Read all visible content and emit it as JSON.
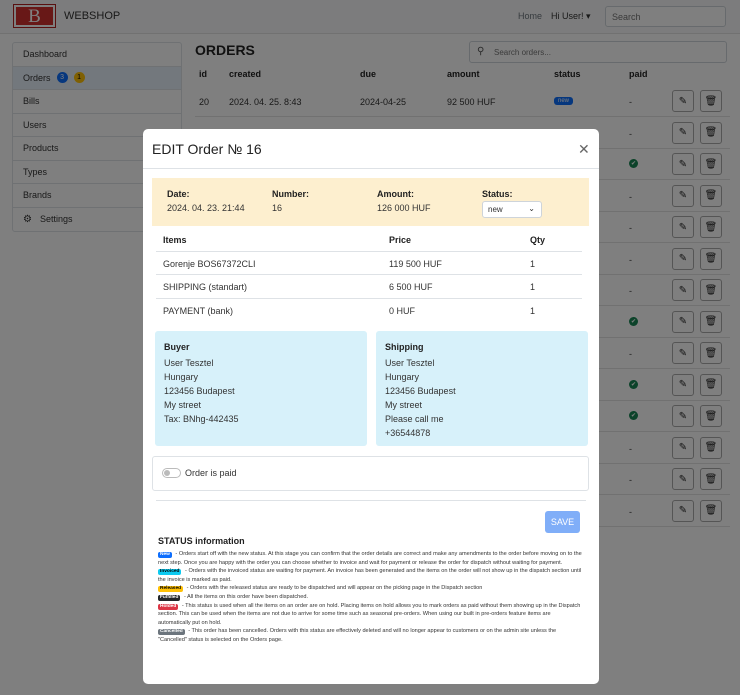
{
  "navbar": {
    "logo_letter": "B",
    "brand": "WEBSHOP",
    "home": "Home",
    "user": "Hi User! ▾",
    "search_placeholder": "Search"
  },
  "sidebar": {
    "items": [
      {
        "label": "Dashboard"
      },
      {
        "label": "Orders",
        "badges": [
          "3",
          "1"
        ]
      },
      {
        "label": "Bills"
      },
      {
        "label": "Users"
      },
      {
        "label": "Products"
      },
      {
        "label": "Types"
      },
      {
        "label": "Brands"
      },
      {
        "label": "Settings",
        "icon": "gear-icon"
      }
    ]
  },
  "orders": {
    "title": "ORDERS",
    "search_placeholder": "Search orders...",
    "headers": {
      "id": "id",
      "created": "created",
      "due": "due",
      "amount": "amount",
      "status": "status",
      "paid": "paid"
    },
    "first_row": {
      "id": "20",
      "created": "2024. 04. 25. 8:43",
      "due": "2024-04-25",
      "amount": "92 500 HUF",
      "status": "new",
      "paid": "-"
    },
    "paid_column": [
      "-",
      "-",
      "✔",
      "-",
      "-",
      "-",
      "-",
      "✔",
      "-",
      "✔",
      "✔",
      "-",
      "-",
      "-"
    ]
  },
  "modal": {
    "title": "EDIT Order № 16",
    "close": "✕",
    "date_label": "Date:",
    "date": "2024. 04. 23. 21:44",
    "number_label": "Number:",
    "number": "16",
    "amount_label": "Amount:",
    "amount": "126 000 HUF",
    "status_label": "Status:",
    "status_value": "new",
    "items_headers": {
      "items": "Items",
      "price": "Price",
      "qty": "Qty"
    },
    "items": [
      {
        "name": "Gorenje BOS67372CLI",
        "price": "119 500 HUF",
        "qty": "1"
      },
      {
        "name": "SHIPPING (standart)",
        "price": "6 500 HUF",
        "qty": "1"
      },
      {
        "name": "PAYMENT (bank)",
        "price": "0 HUF",
        "qty": "1"
      }
    ],
    "buyer": {
      "title": "Buyer",
      "lines": [
        "User Tesztel",
        "Hungary",
        "123456 Budapest",
        "My street",
        "Tax: BNhg-442435"
      ]
    },
    "shipping": {
      "title": "Shipping",
      "lines": [
        "User Tesztel",
        "Hungary",
        "123456 Budapest",
        "My street",
        "Please call me",
        "+36544878"
      ]
    },
    "paid_label": "Order is paid",
    "save": "SAVE",
    "status_info_title": "STATUS information",
    "statuses": [
      {
        "badge": "New",
        "color": "#0d6efd",
        "text_color": "#ffffff",
        "text": " - Orders start off with the new status. At this stage you can confirm that the order details are correct and make any amendments to the order before moving on to the next step. Once you are happy with the order you can choose whether to invoice and wait for payment or release the order for dispatch without waiting for payment."
      },
      {
        "badge": "Invoiced",
        "color": "#0dcaf0",
        "text_color": "#000000",
        "text": " - Orders with the invoiced status are waiting for payment. An invoice has been generated and the items on the order will not show up in the dispatch section until the invoice is marked as paid."
      },
      {
        "badge": "Released",
        "color": "#ffc107",
        "text_color": "#000000",
        "text": " - Orders with the released status are ready to be dispatched and will appear on the picking page in the Dispatch section"
      },
      {
        "badge": "Fulfilled",
        "color": "#212529",
        "text_color": "#ffffff",
        "text": " - All the items on this order have been dispatched."
      },
      {
        "badge": "Holded",
        "color": "#dc3545",
        "text_color": "#ffffff",
        "text": " - This status is used when all the items on an order are on hold. Placing items on hold allows you to mark orders as paid without them showing up in the Dispatch section. This can be used when the items are not due to arrive for some time such as seasonal pre-orders. When using our built in pre-orders feature items are automatically put on hold."
      },
      {
        "badge": "Cancelled",
        "color": "#6c757d",
        "text_color": "#ffffff",
        "text": " - This order has been cancelled. Orders with this status are effectively deleted and will no longer appear to customers or on the admin site unless the \"Cancelled\" status is selected on the Orders page."
      }
    ]
  }
}
